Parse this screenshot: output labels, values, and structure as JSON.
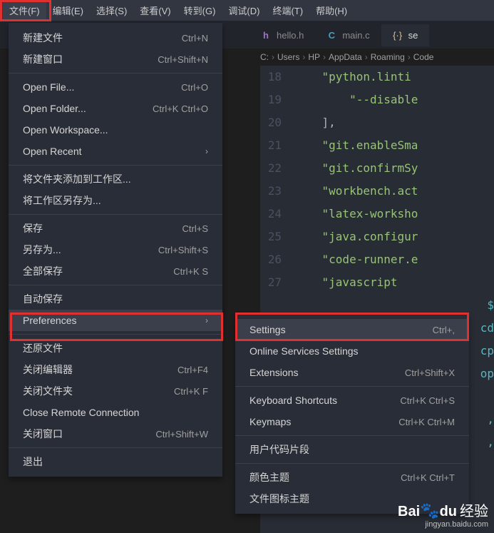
{
  "menubar": {
    "items": [
      {
        "label": "文件(F)"
      },
      {
        "label": "编辑(E)"
      },
      {
        "label": "选择(S)"
      },
      {
        "label": "查看(V)"
      },
      {
        "label": "转到(G)"
      },
      {
        "label": "调试(D)"
      },
      {
        "label": "终端(T)"
      },
      {
        "label": "帮助(H)"
      }
    ]
  },
  "tabs": [
    {
      "icon": "h",
      "icon_color": "#a074c4",
      "label": "hello.h"
    },
    {
      "icon": "C",
      "icon_color": "#519aba",
      "label": "main.c"
    },
    {
      "icon": "{·}",
      "icon_color": "#e2c08d",
      "label": "se"
    }
  ],
  "breadcrumb": [
    "C:",
    "Users",
    "HP",
    "AppData",
    "Roaming",
    "Code"
  ],
  "editor_lines": [
    {
      "no": "18",
      "indent": "    ",
      "content": "\"python.linti"
    },
    {
      "no": "19",
      "indent": "        ",
      "content": "\"--disable"
    },
    {
      "no": "20",
      "indent": "    ",
      "content_plain": "],"
    },
    {
      "no": "21",
      "indent": "    ",
      "content": "\"git.enableSma"
    },
    {
      "no": "22",
      "indent": "    ",
      "content": "\"git.confirmSy"
    },
    {
      "no": "23",
      "indent": "    ",
      "content": "\"workbench.act"
    },
    {
      "no": "24",
      "indent": "    ",
      "content": "\"latex-worksho"
    },
    {
      "no": "25",
      "indent": "    ",
      "content": "\"java.configur"
    },
    {
      "no": "26",
      "indent": "    ",
      "content": "\"code-runner.e"
    },
    {
      "no": "27",
      "indent": "    ",
      "content": "\"javascript"
    },
    {
      "no": "",
      "indent": "",
      "tail": "$"
    },
    {
      "no": "",
      "indent": "",
      "tail": "cd"
    },
    {
      "no": "",
      "indent": "",
      "tail": "cp"
    },
    {
      "no": "",
      "indent": "",
      "tail": "op"
    },
    {
      "no": "",
      "indent": "",
      "tail": ""
    },
    {
      "no": "",
      "indent": "",
      "tail": ","
    },
    {
      "no": "",
      "indent": "",
      "tail": ","
    }
  ],
  "file_menu": [
    {
      "label": "新建文件",
      "shortcut": "Ctrl+N"
    },
    {
      "label": "新建窗口",
      "shortcut": "Ctrl+Shift+N"
    },
    {
      "sep": true
    },
    {
      "label": "Open File...",
      "shortcut": "Ctrl+O"
    },
    {
      "label": "Open Folder...",
      "shortcut": "Ctrl+K Ctrl+O"
    },
    {
      "label": "Open Workspace..."
    },
    {
      "label": "Open Recent",
      "submenu": true
    },
    {
      "sep": true
    },
    {
      "label": "将文件夹添加到工作区..."
    },
    {
      "label": "将工作区另存为..."
    },
    {
      "sep": true
    },
    {
      "label": "保存",
      "shortcut": "Ctrl+S"
    },
    {
      "label": "另存为...",
      "shortcut": "Ctrl+Shift+S"
    },
    {
      "label": "全部保存",
      "shortcut": "Ctrl+K S"
    },
    {
      "sep": true
    },
    {
      "label": "自动保存"
    },
    {
      "label": "Preferences",
      "submenu": true,
      "highlighted": true
    },
    {
      "sep": true
    },
    {
      "label": "还原文件"
    },
    {
      "label": "关闭编辑器",
      "shortcut": "Ctrl+F4"
    },
    {
      "label": "关闭文件夹",
      "shortcut": "Ctrl+K F"
    },
    {
      "label": "Close Remote Connection"
    },
    {
      "label": "关闭窗口",
      "shortcut": "Ctrl+Shift+W"
    },
    {
      "sep": true
    },
    {
      "label": "退出"
    }
  ],
  "prefs_submenu": [
    {
      "label": "Settings",
      "shortcut": "Ctrl+,",
      "highlighted": true
    },
    {
      "label": "Online Services Settings"
    },
    {
      "label": "Extensions",
      "shortcut": "Ctrl+Shift+X"
    },
    {
      "sep": true
    },
    {
      "label": "Keyboard Shortcuts",
      "shortcut": "Ctrl+K Ctrl+S"
    },
    {
      "label": "Keymaps",
      "shortcut": "Ctrl+K Ctrl+M"
    },
    {
      "sep": true
    },
    {
      "label": "用户代码片段"
    },
    {
      "sep": true
    },
    {
      "label": "颜色主题",
      "shortcut": "Ctrl+K Ctrl+T"
    },
    {
      "label": "文件图标主题"
    }
  ],
  "watermark": {
    "main": "Bai",
    "du": "du",
    "suffix": "经验",
    "sub": "jingyan.baidu.com"
  }
}
